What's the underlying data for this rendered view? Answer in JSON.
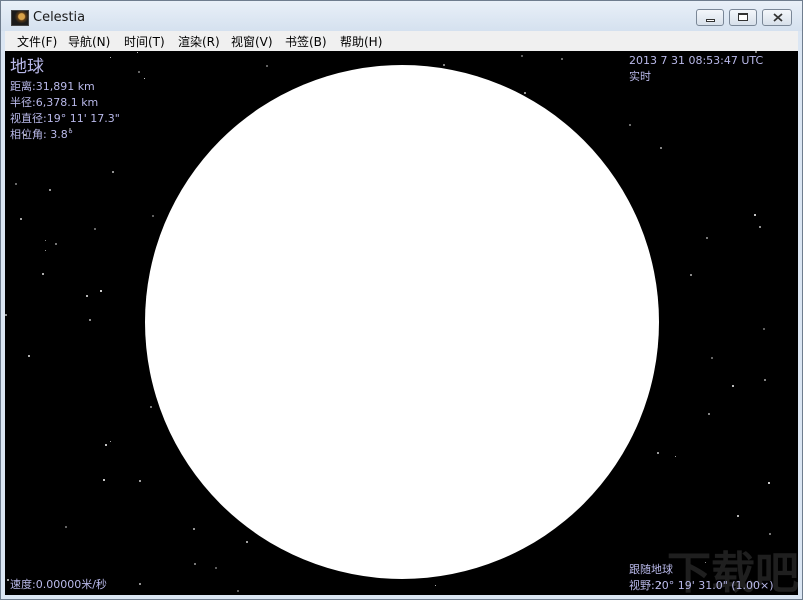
{
  "window": {
    "title": "Celestia",
    "controls": [
      "minimize",
      "maximize",
      "close"
    ]
  },
  "menu": [
    {
      "label": "文件(F)"
    },
    {
      "label": "导航(N)"
    },
    {
      "label": "时间(T)"
    },
    {
      "label": "渲染(R)"
    },
    {
      "label": "视窗(V)"
    },
    {
      "label": "书签(B)"
    },
    {
      "label": "帮助(H)"
    }
  ],
  "object_info": {
    "name": "地球",
    "distance": "距离:31,891 km",
    "radius": "半径:6,378.1 km",
    "apparent_diameter": "视直径:19° 11' 17.3\"",
    "phase_angle": "相位角: 3.8°"
  },
  "time_info": {
    "datetime": "2013 7 31 08:53:47 UTC",
    "mode": "实时"
  },
  "status": {
    "speed": "速度:0.00000米/秒",
    "tracking": "跟随地球",
    "fov": "视野:20° 19' 31.0\" (1.00×)"
  },
  "watermark": "下载吧",
  "colors": {
    "hud_text": "#b9b9ea",
    "space": "#000000",
    "planet": "#ffffff"
  }
}
